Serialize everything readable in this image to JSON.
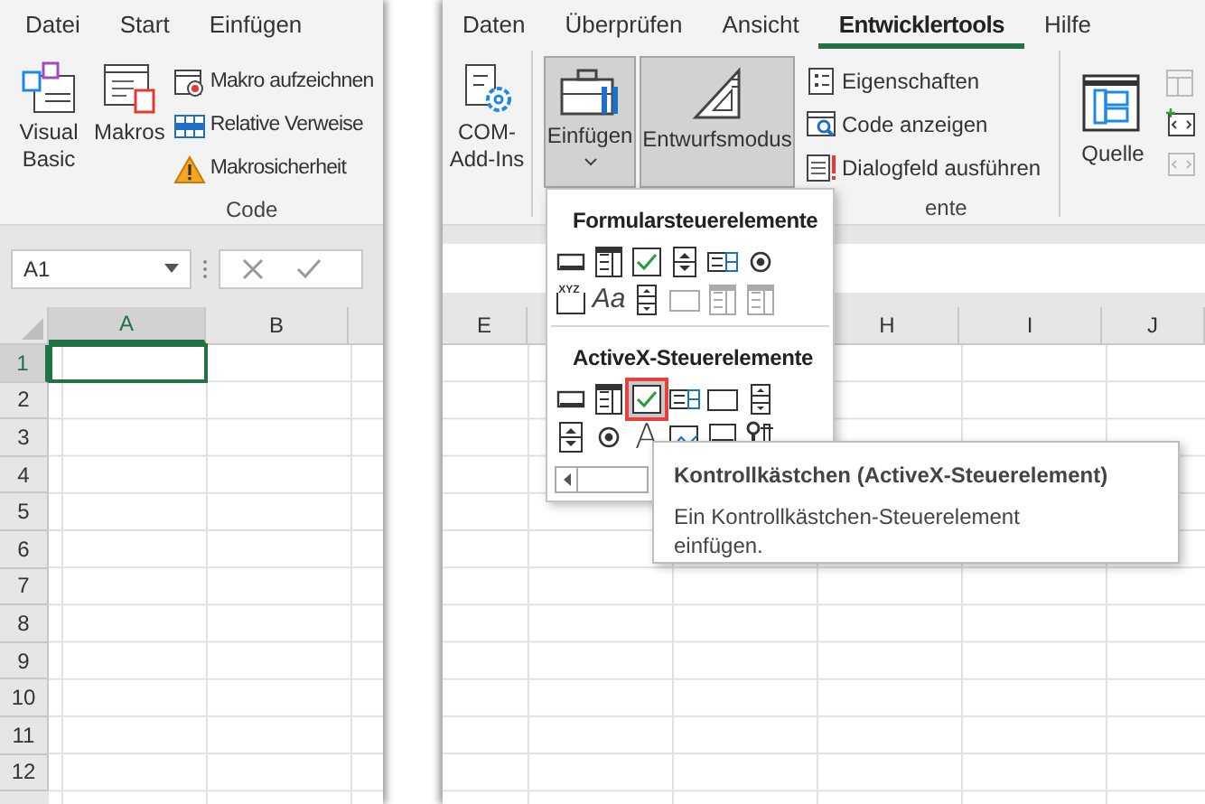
{
  "left_tabs": [
    {
      "label": "Datei",
      "selected": false
    },
    {
      "label": "Start",
      "selected": false
    },
    {
      "label": "Einfügen",
      "selected": false
    }
  ],
  "right_tabs": [
    {
      "label": "Daten",
      "selected": false
    },
    {
      "label": "Überprüfen",
      "selected": false
    },
    {
      "label": "Ansicht",
      "selected": false
    },
    {
      "label": "Entwicklertools",
      "selected": true
    },
    {
      "label": "Hilfe",
      "selected": false
    }
  ],
  "code_group": {
    "large_buttons": [
      {
        "label": "Visual Basic",
        "kind": "vba"
      },
      {
        "label": "Makros",
        "kind": "macros"
      }
    ],
    "small_buttons": [
      {
        "label": "Makro aufzeichnen",
        "kind": "record"
      },
      {
        "label": "Relative Verweise",
        "kind": "relative"
      },
      {
        "label": "Makrosicherheit",
        "kind": "security"
      }
    ],
    "label": "Code"
  },
  "addins_group": {
    "buttons": [
      {
        "label": "COM-Add-Ins",
        "kind": "com"
      }
    ]
  },
  "controls_group": {
    "large_buttons": [
      {
        "label": "Einfügen",
        "kind": "insert",
        "pressed": true,
        "dropdown": true
      },
      {
        "label": "Entwurfsmodus",
        "kind": "design",
        "pressed": true,
        "dropdown": false
      }
    ],
    "small_buttons": [
      {
        "label": "Eigenschaften",
        "kind": "properties"
      },
      {
        "label": "Code anzeigen",
        "kind": "viewcode"
      },
      {
        "label": "Dialogfeld ausführen",
        "kind": "dialog"
      }
    ],
    "label": "ente"
  },
  "xml_group": {
    "buttons": [
      {
        "label": "Quelle",
        "kind": "source"
      }
    ]
  },
  "name_box": {
    "value": "A1"
  },
  "left_columns": [
    {
      "label": "A",
      "selected": true
    },
    {
      "label": "B",
      "selected": false
    }
  ],
  "right_columns": [
    {
      "label": "E",
      "selected": false
    },
    {
      "label": "H",
      "selected": false
    },
    {
      "label": "I",
      "selected": false
    },
    {
      "label": "J",
      "selected": false
    }
  ],
  "rows": [
    {
      "label": "1",
      "selected": true
    },
    {
      "label": "2",
      "selected": false
    },
    {
      "label": "3",
      "selected": false
    },
    {
      "label": "4",
      "selected": false
    },
    {
      "label": "5",
      "selected": false
    },
    {
      "label": "6",
      "selected": false
    },
    {
      "label": "7",
      "selected": false
    },
    {
      "label": "8",
      "selected": false
    },
    {
      "label": "9",
      "selected": false
    },
    {
      "label": "10",
      "selected": false
    },
    {
      "label": "11",
      "selected": false
    },
    {
      "label": "12",
      "selected": false
    }
  ],
  "insert_menu": {
    "sections": [
      {
        "title": "Formularsteuerelemente",
        "controls": [
          {
            "kind": "button",
            "disabled": false,
            "selected": false
          },
          {
            "kind": "combo",
            "disabled": false,
            "selected": false
          },
          {
            "kind": "checkbox",
            "disabled": false,
            "selected": false
          },
          {
            "kind": "spin",
            "disabled": false,
            "selected": false
          },
          {
            "kind": "listbox",
            "disabled": false,
            "selected": false
          },
          {
            "kind": "option",
            "disabled": false,
            "selected": false
          },
          {
            "kind": "groupbox",
            "glyph": "XYZ",
            "disabled": false,
            "selected": false
          },
          {
            "kind": "label",
            "glyph": "Aa",
            "disabled": false,
            "selected": false
          },
          {
            "kind": "scrollbar",
            "disabled": false,
            "selected": false
          },
          {
            "kind": "textfield",
            "disabled": true,
            "selected": false
          },
          {
            "kind": "combolist",
            "disabled": true,
            "selected": false
          },
          {
            "kind": "combodrop",
            "disabled": true,
            "selected": false
          }
        ]
      },
      {
        "title": "ActiveX-Steuerelemente",
        "controls": [
          {
            "kind": "button",
            "disabled": false,
            "selected": false
          },
          {
            "kind": "combo",
            "disabled": false,
            "selected": false
          },
          {
            "kind": "checkbox",
            "disabled": false,
            "selected": true
          },
          {
            "kind": "listbox",
            "disabled": false,
            "selected": false
          },
          {
            "kind": "textfield",
            "disabled": false,
            "selected": false
          },
          {
            "kind": "scrollbar",
            "disabled": false,
            "selected": false
          },
          {
            "kind": "spin",
            "disabled": false,
            "selected": false
          },
          {
            "kind": "option",
            "disabled": false,
            "selected": false
          },
          {
            "kind": "biglabel",
            "glyph": "A",
            "disabled": false,
            "selected": false
          },
          {
            "kind": "image",
            "disabled": false,
            "selected": false
          },
          {
            "kind": "toggle",
            "disabled": false,
            "selected": false
          },
          {
            "kind": "more",
            "disabled": false,
            "selected": false
          }
        ]
      }
    ]
  },
  "tooltip": {
    "title": "Kontrollkästchen (ActiveX-Steuerelement)",
    "text": "Ein Kontrollkästchen-Steuerelement einfügen."
  }
}
